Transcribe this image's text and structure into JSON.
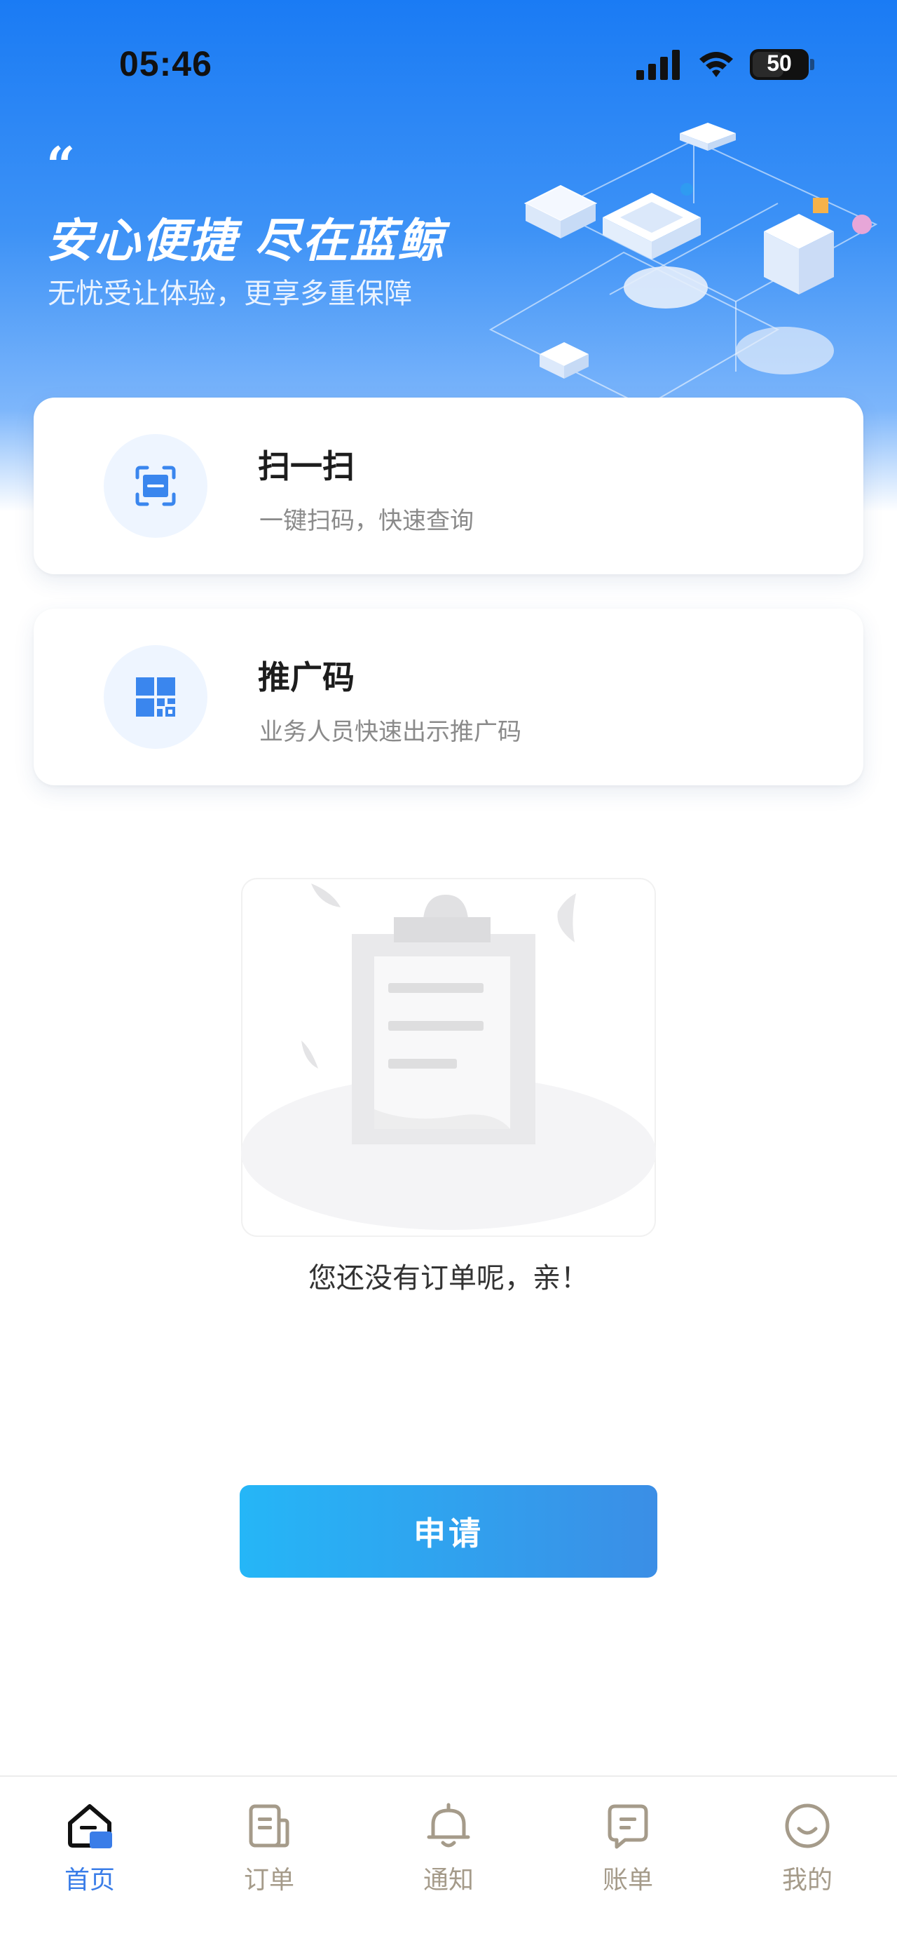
{
  "status_bar": {
    "time": "05:46",
    "battery": "50"
  },
  "hero": {
    "quote": "“",
    "title": "安心便捷 尽在蓝鲸",
    "subtitle": "无忧受让体验，更享多重保障"
  },
  "cards": [
    {
      "title": "扫一扫",
      "description": "一键扫码，快速查询",
      "icon": "scan-icon"
    },
    {
      "title": "推广码",
      "description": "业务人员快速出示推广码",
      "icon": "qr-code-icon"
    }
  ],
  "empty_state": {
    "message": "您还没有订单呢，亲！",
    "icon": "empty-clipboard-illustration"
  },
  "apply_button": {
    "label": "申请"
  },
  "tab_bar": {
    "items": [
      {
        "label": "首页",
        "icon": "home-icon",
        "active": true
      },
      {
        "label": "订单",
        "icon": "order-icon",
        "active": false
      },
      {
        "label": "通知",
        "icon": "bell-icon",
        "active": false
      },
      {
        "label": "账单",
        "icon": "bill-icon",
        "active": false
      },
      {
        "label": "我的",
        "icon": "profile-icon",
        "active": false
      }
    ]
  },
  "colors": {
    "brand_blue": "#1a7bf4",
    "active_tab": "#3a7de8",
    "inactive_tab": "#a59b8a",
    "button_start": "#25b6f7",
    "button_end": "#3b8ee6"
  }
}
